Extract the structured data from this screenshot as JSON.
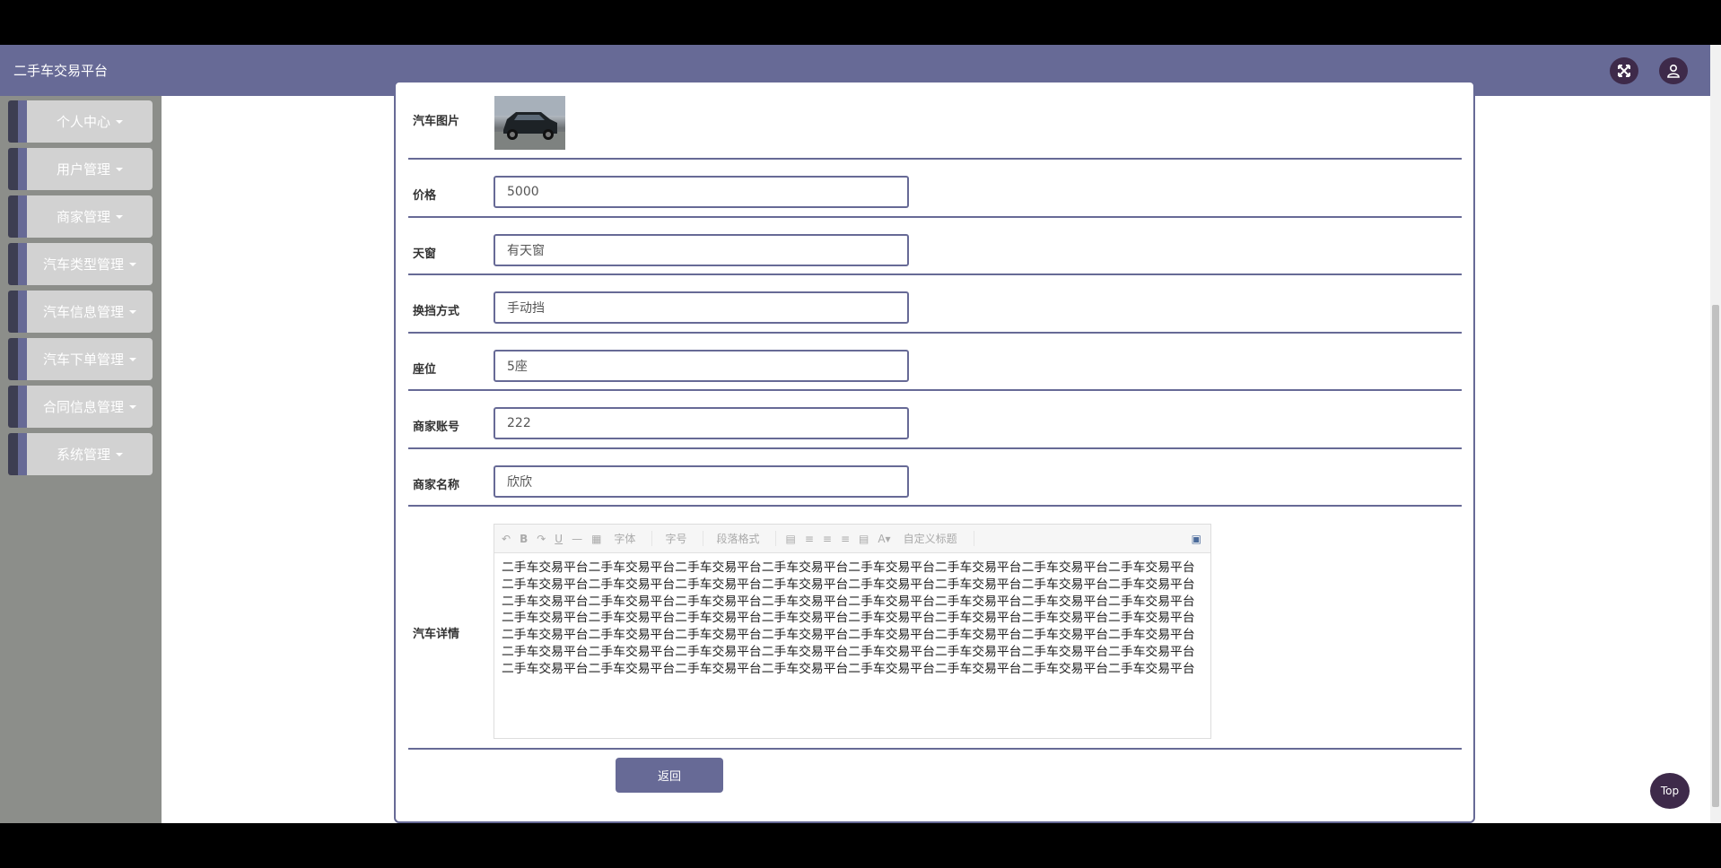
{
  "header": {
    "brand": "二手车交易平台"
  },
  "sidebar": {
    "items": [
      {
        "label": "个人中心"
      },
      {
        "label": "用户管理"
      },
      {
        "label": "商家管理"
      },
      {
        "label": "汽车类型管理"
      },
      {
        "label": "汽车信息管理"
      },
      {
        "label": "汽车下单管理"
      },
      {
        "label": "合同信息管理"
      },
      {
        "label": "系统管理"
      }
    ]
  },
  "form": {
    "image_label": "汽车图片",
    "fields": [
      {
        "label": "价格",
        "value": "5000"
      },
      {
        "label": "天窗",
        "value": "有天窗"
      },
      {
        "label": "换挡方式",
        "value": "手动挡"
      },
      {
        "label": "座位",
        "value": "5座"
      },
      {
        "label": "商家账号",
        "value": "222"
      },
      {
        "label": "商家名称",
        "value": "欣欣"
      }
    ],
    "details_label": "汽车详情",
    "toolbar": {
      "font": "字体",
      "size": "字号",
      "paragraph": "段落格式",
      "custom": "自定义标题"
    },
    "details_text": "二手车交易平台二手车交易平台二手车交易平台二手车交易平台二手车交易平台二手车交易平台二手车交易平台二手车交易平台二手车交易平台二手车交易平台二手车交易平台二手车交易平台二手车交易平台二手车交易平台二手车交易平台二手车交易平台二手车交易平台二手车交易平台二手车交易平台二手车交易平台二手车交易平台二手车交易平台二手车交易平台二手车交易平台二手车交易平台二手车交易平台二手车交易平台二手车交易平台二手车交易平台二手车交易平台二手车交易平台二手车交易平台二手车交易平台二手车交易平台二手车交易平台二手车交易平台二手车交易平台二手车交易平台二手车交易平台二手车交易平台二手车交易平台二手车交易平台二手车交易平台二手车交易平台二手车交易平台二手车交易平台二手车交易平台二手车交易平台二手车交易平台二手车交易平台二手车交易平台二手车交易平台二手车交易平台二手车交易平台二手车交易平台二手车交易平台",
    "back_label": "返回"
  },
  "top_button": "Top",
  "colors": {
    "primary": "#676a96",
    "dark": "#3e2a4a",
    "sidebar_bg": "#8c8e8a",
    "menu_bg": "#d2d2d2"
  }
}
